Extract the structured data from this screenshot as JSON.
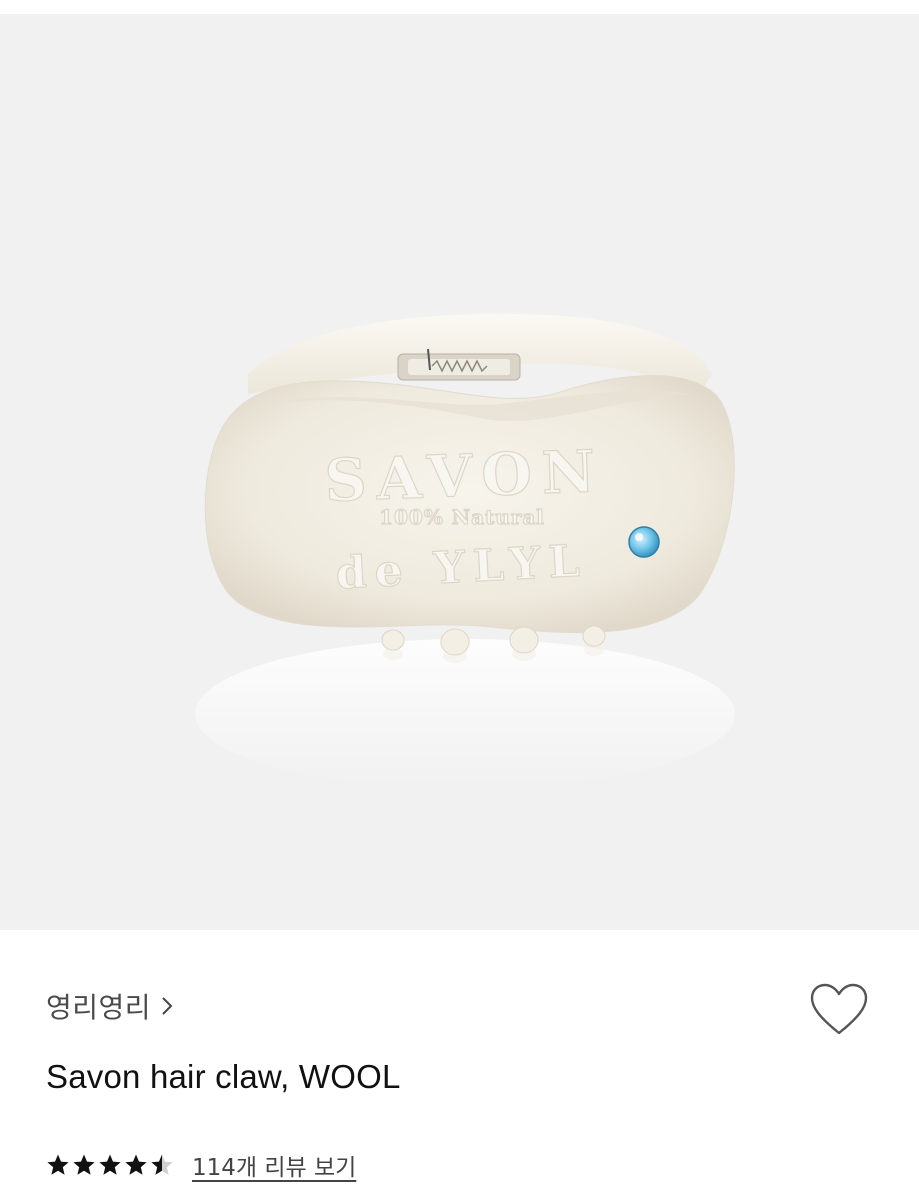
{
  "product": {
    "brand": "영리영리",
    "title": "Savon hair claw, WOOL",
    "rating": 4.5,
    "rating_max": 5,
    "review_link": "114개 리뷰 보기",
    "image_embossed_text": [
      "SAVON",
      "100% Natural",
      "de YLYL"
    ]
  },
  "colors": {
    "hero_background": "#f1f1f1",
    "claw_color": "#f4f0e6",
    "gem_color": "#6ec3e6",
    "star_color": "#111111"
  },
  "icons": {
    "brand_chevron": "chevron-right-icon",
    "wish": "heart-outline-icon",
    "star": "star-icon"
  }
}
